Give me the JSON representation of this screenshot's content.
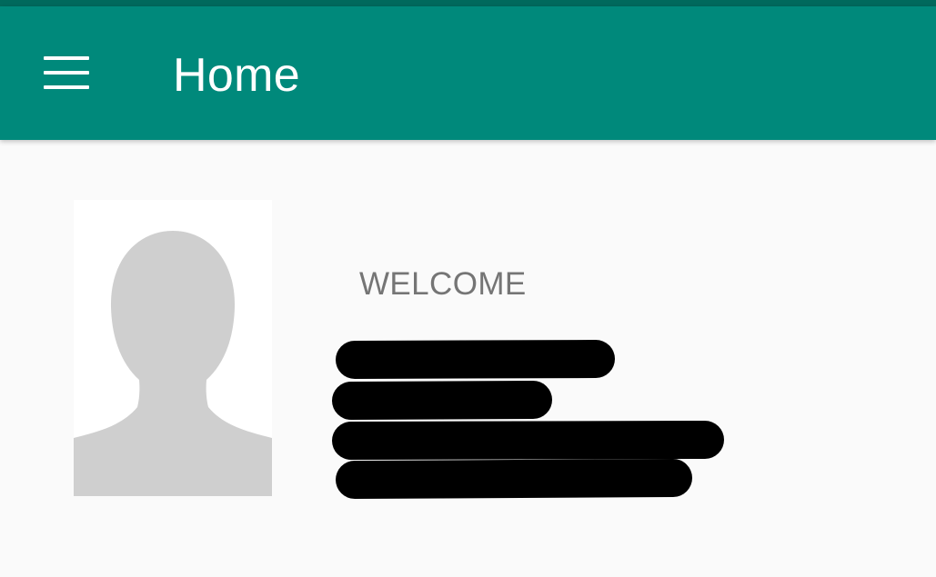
{
  "app_bar": {
    "title": "Home",
    "menu_icon": "hamburger-menu-icon",
    "color": "#00897b",
    "status_bar_color": "#00695c"
  },
  "profile": {
    "avatar_icon": "default-person-avatar",
    "welcome_label": "WELCOME",
    "redacted_lines": 4
  }
}
